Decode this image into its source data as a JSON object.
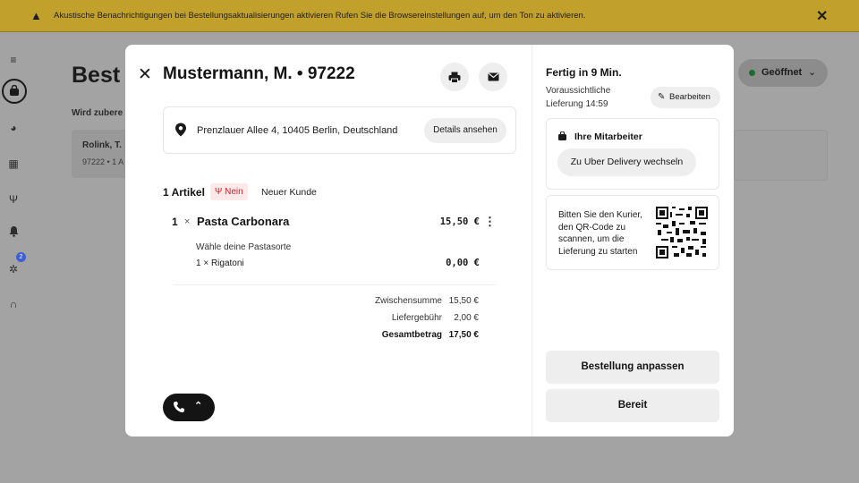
{
  "banner": {
    "message": "Akustische Benachrichtigungen bei Bestellungsaktualisierungen aktivieren Rufen Sie die Browsereinstellungen auf, um den Ton zu aktivieren.",
    "close_glyph": "✕",
    "warn_glyph": "▲"
  },
  "background": {
    "title": "Best",
    "subheading": "Wird zubere",
    "card_name": "Rolink, T.",
    "card_meta": "97222 • 1 A",
    "status": "Geöffnet",
    "notification_count": "2"
  },
  "modal": {
    "title": "Mustermann, M. • 97222",
    "address": "Prenzlauer Allee 4, 10405 Berlin, Deutschland",
    "details_label": "Details ansehen",
    "items_count": "1 Artikel",
    "cutlery_label": "Nein",
    "customer_tag": "Neuer Kunde",
    "item": {
      "qty": "1",
      "times": "×",
      "name": "Pasta Carbonara",
      "price": "15,50 €",
      "option_group": "Wähle deine Pastasorte",
      "option": "1 × Rigatoni",
      "option_price": "0,00 €"
    },
    "totals": {
      "subtotal_label": "Zwischensumme",
      "subtotal": "15,50 €",
      "delivery_label": "Liefergebühr",
      "delivery": "2,00 €",
      "total_label": "Gesamtbetrag",
      "total": "17,50 €"
    }
  },
  "sidebar_right": {
    "ready_title": "Fertig in  9 Min.",
    "eta_line1": "Voraussichtliche",
    "eta_line2": "Lieferung 14:59",
    "edit_label": "Bearbeiten",
    "staff_heading": "Ihre Mitarbeiter",
    "switch_label": "Zu Uber Delivery wechseln",
    "qr_text": "Bitten Sie den Kurier, den QR-Code zu scannen, um die Lieferung zu starten",
    "adjust_label": "Bestellung anpassen",
    "ready_label": "Bereit"
  },
  "colors": {
    "banner": "#c2a02c",
    "cutlery_red": "#c8252c",
    "open_green": "#1c6b31",
    "badge_blue": "#3c5fd6"
  }
}
